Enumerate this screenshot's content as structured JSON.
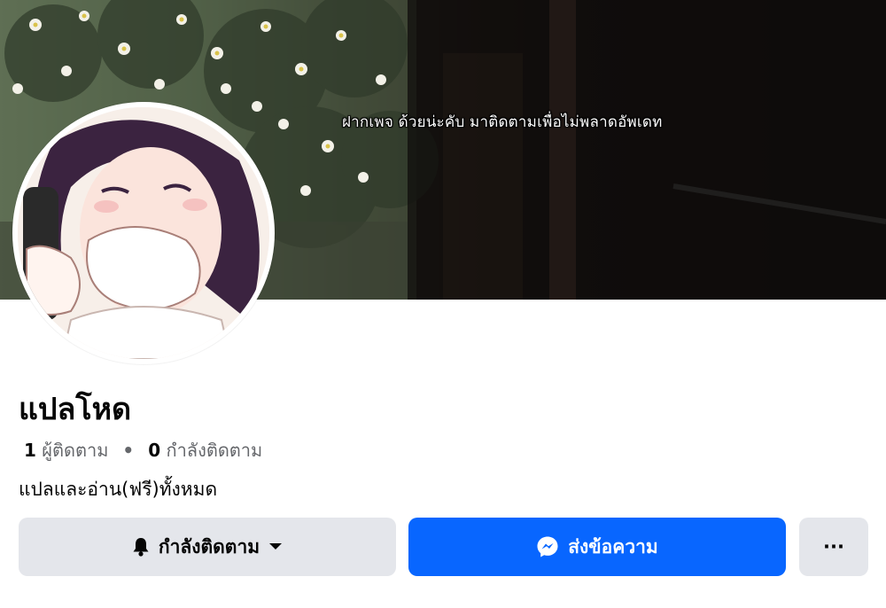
{
  "cover": {
    "caption": "ฝากเพจ ด้วยน่ะคับ มาติดตามเพื่อไม่พลาดอัพเดท"
  },
  "profile": {
    "name": "แปลโหด",
    "followers_count": "1",
    "followers_label": "ผู้ติดตาม",
    "separator": "•",
    "following_count": "0",
    "following_label": "กำลังติดตาม",
    "bio": "แปลและอ่าน(ฟรี)ทั้งหมด"
  },
  "actions": {
    "follow_label": "กำลังติดตาม",
    "message_label": "ส่งข้อความ",
    "more_label": "···"
  },
  "icons": {
    "bell": "bell-icon",
    "caret": "caret-down-icon",
    "messenger": "messenger-icon",
    "more": "more-icon"
  },
  "colors": {
    "primary": "#0866ff",
    "secondary_button": "#e4e6eb",
    "muted_text": "#65676b"
  }
}
